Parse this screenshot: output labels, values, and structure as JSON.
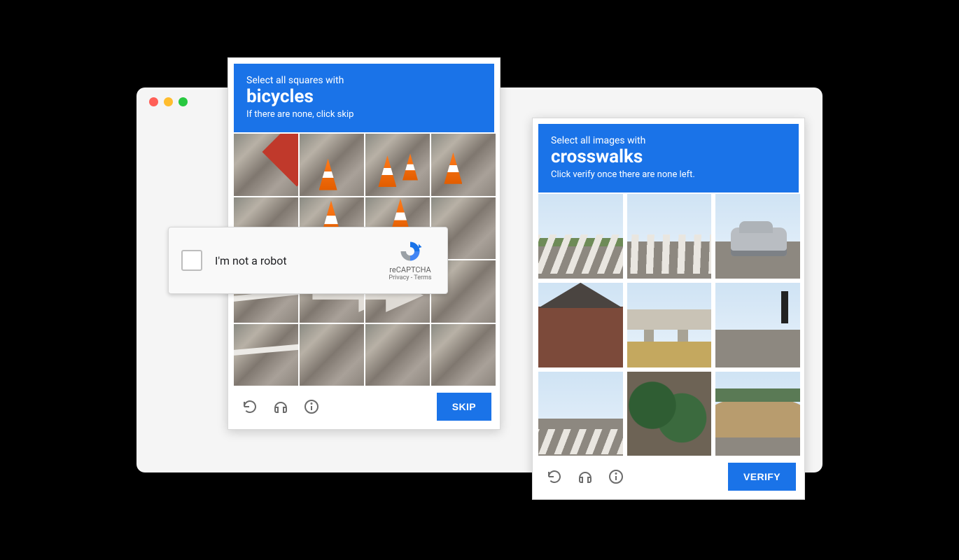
{
  "colors": {
    "accent": "#1a73e8"
  },
  "window": {
    "traffic_lights": [
      "close",
      "minimize",
      "zoom"
    ]
  },
  "anchor": {
    "label": "I'm not a robot",
    "brand": "reCAPTCHA",
    "privacy": "Privacy",
    "terms": "Terms",
    "separator": " - "
  },
  "challenges": {
    "left": {
      "line1": "Select all squares with",
      "target": "bicycles",
      "line2": "If there are none, click skip",
      "grid": "4x4",
      "action": "SKIP",
      "footer_icons": [
        "reload",
        "audio",
        "info"
      ]
    },
    "right": {
      "line1": "Select all images with",
      "target": "crosswalks",
      "line2": "Click verify once there are none left.",
      "grid": "3x3",
      "action": "VERIFY",
      "footer_icons": [
        "reload",
        "audio",
        "info"
      ]
    }
  }
}
